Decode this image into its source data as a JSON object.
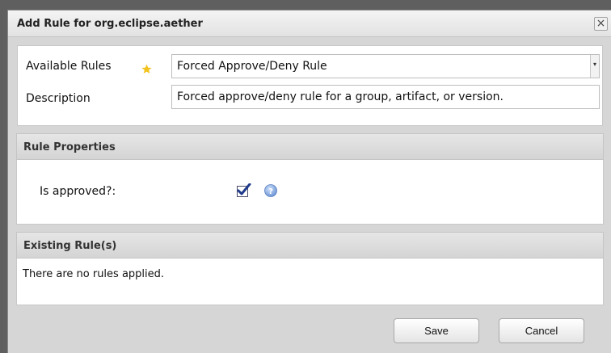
{
  "dialog": {
    "title": "Add Rule for org.eclipse.aether",
    "close_label": "×"
  },
  "form": {
    "available_rules_label": "Available Rules",
    "available_rules_value": "Forced Approve/Deny Rule",
    "description_label": "Description",
    "description_value": "Forced approve/deny rule for a group, artifact, or version."
  },
  "rule_properties": {
    "header": "Rule Properties",
    "is_approved_label": "Is approved?:",
    "is_approved_checked": true
  },
  "existing_rules": {
    "header": "Existing Rule(s)",
    "empty_text": "There are no rules applied."
  },
  "buttons": {
    "save": "Save",
    "cancel": "Cancel"
  },
  "icons": {
    "required": "star-icon",
    "help": "question-icon",
    "close": "close-icon"
  },
  "colors": {
    "required_star": "#f2c31d",
    "help_icon": "#6f97d6",
    "checkmark": "#1f3a8a"
  }
}
